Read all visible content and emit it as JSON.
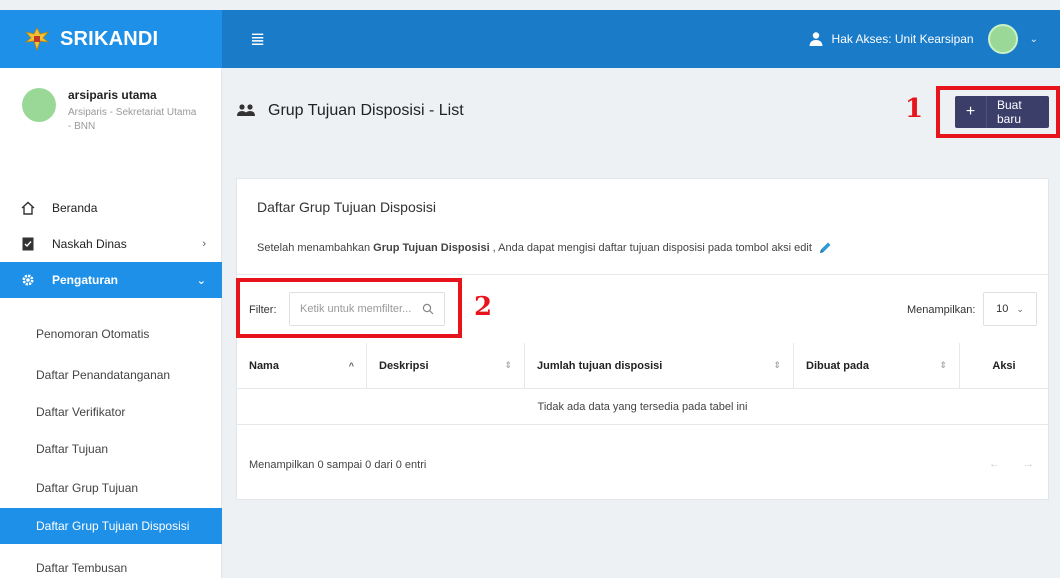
{
  "app": {
    "name": "SRIKANDI"
  },
  "topbar": {
    "access_label": "Hak Akses: Unit Kearsipan"
  },
  "profile": {
    "name": "arsiparis utama",
    "role": "Arsiparis - Sekretariat Utama - BNN"
  },
  "nav": [
    {
      "label": "Beranda",
      "icon": "home-icon"
    },
    {
      "label": "Naskah Dinas",
      "icon": "document-icon",
      "chevron": "›"
    },
    {
      "label": "Pengaturan",
      "icon": "gear-icon",
      "chevron": "⌄",
      "active": true
    }
  ],
  "subnav": [
    {
      "label": "Penomoran Otomatis"
    },
    {
      "label": "Daftar Penandatanganan"
    },
    {
      "label": "Daftar Verifikator"
    },
    {
      "label": "Daftar Tujuan"
    },
    {
      "label": "Daftar Grup Tujuan"
    },
    {
      "label": "Daftar Grup Tujuan Disposisi",
      "active": true
    },
    {
      "label": "Daftar Tembusan"
    }
  ],
  "page": {
    "title_bold": "Grup Tujuan Disposisi",
    "title_rest": " - List"
  },
  "new_button": {
    "icon": "+",
    "label": "Buat baru"
  },
  "annotations": {
    "one": "1",
    "two": "2"
  },
  "card": {
    "title": "Daftar Grup Tujuan Disposisi",
    "desc_pre": "Setelah menambahkan",
    "desc_bold": "Grup Tujuan Disposisi",
    "desc_post": ", Anda dapat mengisi daftar tujuan disposisi pada tombol aksi edit"
  },
  "filter": {
    "label": "Filter:",
    "placeholder": "Ketik untuk memfilter..."
  },
  "show": {
    "label": "Menampilkan:",
    "value": "10"
  },
  "table": {
    "columns": [
      "Nama",
      "Deskripsi",
      "Jumlah tujuan disposisi",
      "Dibuat pada",
      "Aksi"
    ],
    "empty_text": "Tidak ada data yang tersedia pada tabel ini"
  },
  "footer": {
    "info": "Menampilkan 0 sampai 0 dari 0 entri",
    "pager": "← →"
  },
  "colors": {
    "brand": "#1e90e8",
    "topbar": "#1a7bc9",
    "button": "#3a3e69",
    "annotation": "#e8141b"
  }
}
